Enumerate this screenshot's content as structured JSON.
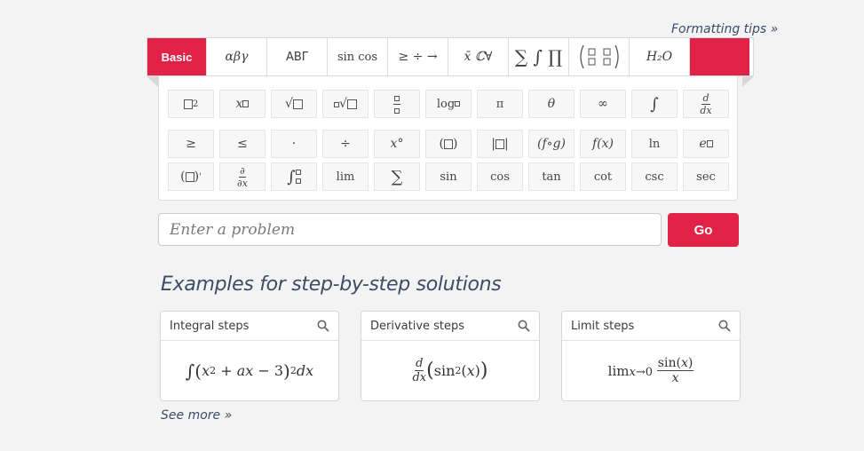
{
  "formatting_tips": "Formatting tips »",
  "tabs": [
    {
      "label": "Basic",
      "active": true
    },
    {
      "label": "αβγ"
    },
    {
      "label": "ΑΒΓ"
    },
    {
      "label": "sin cos"
    },
    {
      "label": "≥ ÷ →"
    },
    {
      "label": "x̄ ℂ∀"
    },
    {
      "label": "∑ ∫ ∏"
    },
    {
      "label": "matrix"
    },
    {
      "label": "H₂O"
    },
    {
      "label": ""
    }
  ],
  "palette": {
    "row1": [
      "□²",
      "x□",
      "√□",
      "∜□",
      "□/□",
      "log□",
      "π",
      "θ",
      "∞",
      "∫",
      "d/dx"
    ],
    "row2": [
      "≥",
      "≤",
      "·",
      "÷",
      "x°",
      "(□)",
      "|□|",
      "(f∘g)",
      "f(x)",
      "ln",
      "e□"
    ],
    "row3": [
      "(□)'",
      "∂/∂x",
      "∫□□",
      "lim",
      "∑",
      "sin",
      "cos",
      "tan",
      "cot",
      "csc",
      "sec"
    ]
  },
  "search": {
    "placeholder": "Enter a problem",
    "value": "",
    "go_label": "Go"
  },
  "examples": {
    "title": "Examples for step-by-step solutions",
    "cards": [
      {
        "title": "Integral steps",
        "expression": "∫(x² + ax − 3)² dx"
      },
      {
        "title": "Derivative steps",
        "expression": "d/dx (sin²(x))"
      },
      {
        "title": "Limit steps",
        "expression": "lim x→0 sin(x)/x"
      }
    ],
    "see_more": "See more »"
  },
  "colors": {
    "accent": "#e12247",
    "link": "#3b4d66",
    "background": "#f4f3f4"
  }
}
